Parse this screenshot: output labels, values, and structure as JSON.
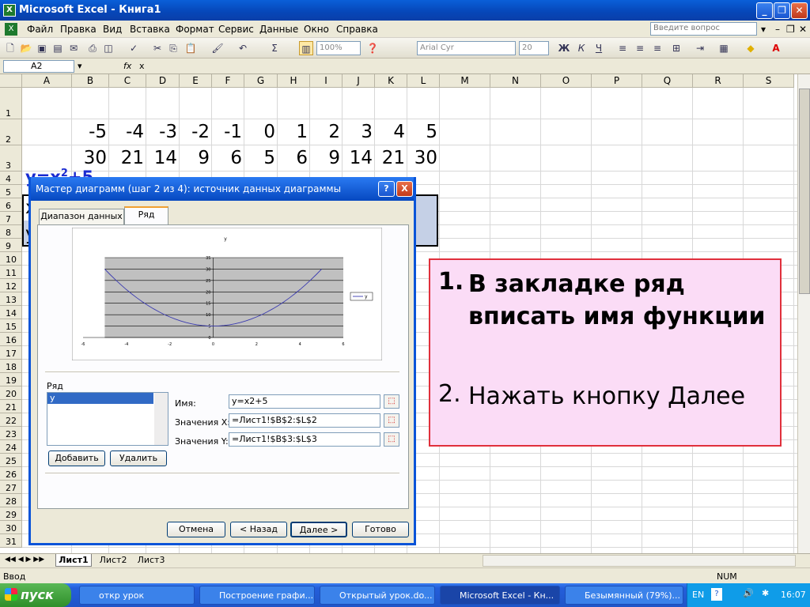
{
  "window": {
    "title": "Microsoft Excel - Книга1",
    "app_icon": "X"
  },
  "menu": {
    "items": [
      "Файл",
      "Правка",
      "Вид",
      "Вставка",
      "Формат",
      "Сервис",
      "Данные",
      "Окно",
      "Справка"
    ],
    "ask_placeholder": "Введите вопрос"
  },
  "toolbar": {
    "zoom": "100%",
    "font": "Arial Cyr",
    "size": "20",
    "bold": "Ж",
    "italic": "К",
    "underline": "Ч"
  },
  "formula_bar": {
    "name_box": "A2",
    "fx": "fx",
    "content": "x"
  },
  "sheet": {
    "columns": [
      "A",
      "B",
      "C",
      "D",
      "E",
      "F",
      "G",
      "H",
      "I",
      "J",
      "K",
      "L",
      "M",
      "N",
      "O",
      "P",
      "Q",
      "R",
      "S"
    ],
    "rows": [
      "1",
      "2",
      "3",
      "4",
      "5",
      "6",
      "7",
      "8",
      "9",
      "10",
      "11",
      "12",
      "13",
      "14",
      "15",
      "16",
      "17",
      "18",
      "19",
      "20",
      "21",
      "22",
      "23",
      "24",
      "25",
      "26",
      "27",
      "28",
      "29",
      "30",
      "31"
    ],
    "a1_base": "y=x",
    "a1_sup": "2",
    "a1_tail": "+5",
    "row2_label": "x",
    "row3_label": "y",
    "x_values": [
      "-5",
      "-4",
      "-3",
      "-2",
      "-1",
      "0",
      "1",
      "2",
      "3",
      "4",
      "5"
    ],
    "y_values": [
      "30",
      "21",
      "14",
      "9",
      "6",
      "5",
      "6",
      "9",
      "14",
      "21",
      "30"
    ]
  },
  "dialog": {
    "title": "Мастер диаграмм (шаг 2 из 4): источник данных диаграммы",
    "tabs": [
      "Диапазон данных",
      "Ряд"
    ],
    "series_label": "Ряд",
    "series_items": [
      "y"
    ],
    "add_button": "Добавить",
    "remove_button": "Удалить",
    "name_label": "Имя:",
    "name_value": "y=x2+5",
    "xvals_label": "Значения X:",
    "xvals_value": "=Лист1!$B$2:$L$2",
    "yvals_label": "Значения Y:",
    "yvals_value": "=Лист1!$B$3:$L$3",
    "cancel": "Отмена",
    "back": "< Назад",
    "next": "Далее >",
    "finish": "Готово",
    "help": "?",
    "close": "X"
  },
  "chart_data": {
    "type": "line",
    "title": "y",
    "x": [
      -5,
      -4,
      -3,
      -2,
      -1,
      0,
      1,
      2,
      3,
      4,
      5
    ],
    "series": [
      {
        "name": "y",
        "values": [
          30,
          21,
          14,
          9,
          6,
          5,
          6,
          9,
          14,
          21,
          30
        ]
      }
    ],
    "xlim": [
      -6,
      6
    ],
    "ylim": [
      0,
      35
    ],
    "xticks": [
      "-6",
      "-4",
      "-2",
      "0",
      "2",
      "4",
      "6"
    ],
    "yticks": [
      "0",
      "5",
      "10",
      "15",
      "20",
      "25",
      "30",
      "35"
    ],
    "grid": true,
    "legend": "right",
    "line_color": "#3a3ab0",
    "plot_bg": "#c0c0c0"
  },
  "callout": {
    "item1_num": "1.",
    "item1_text": "В закладке ряд вписать имя функции",
    "item2_num": "2.",
    "item2_text": "Нажать кнопку Далее"
  },
  "sheet_tabs": [
    "Лист1",
    "Лист2",
    "Лист3"
  ],
  "status": {
    "left": "Ввод",
    "right": "NUM"
  },
  "taskbar": {
    "start": "пуск",
    "tasks": [
      "откр урок",
      "Построение графи...",
      "Открытый урок.do...",
      "Microsoft Excel - Кн...",
      "Безымянный (79%)..."
    ],
    "lang": "EN",
    "clock": "16:07"
  }
}
